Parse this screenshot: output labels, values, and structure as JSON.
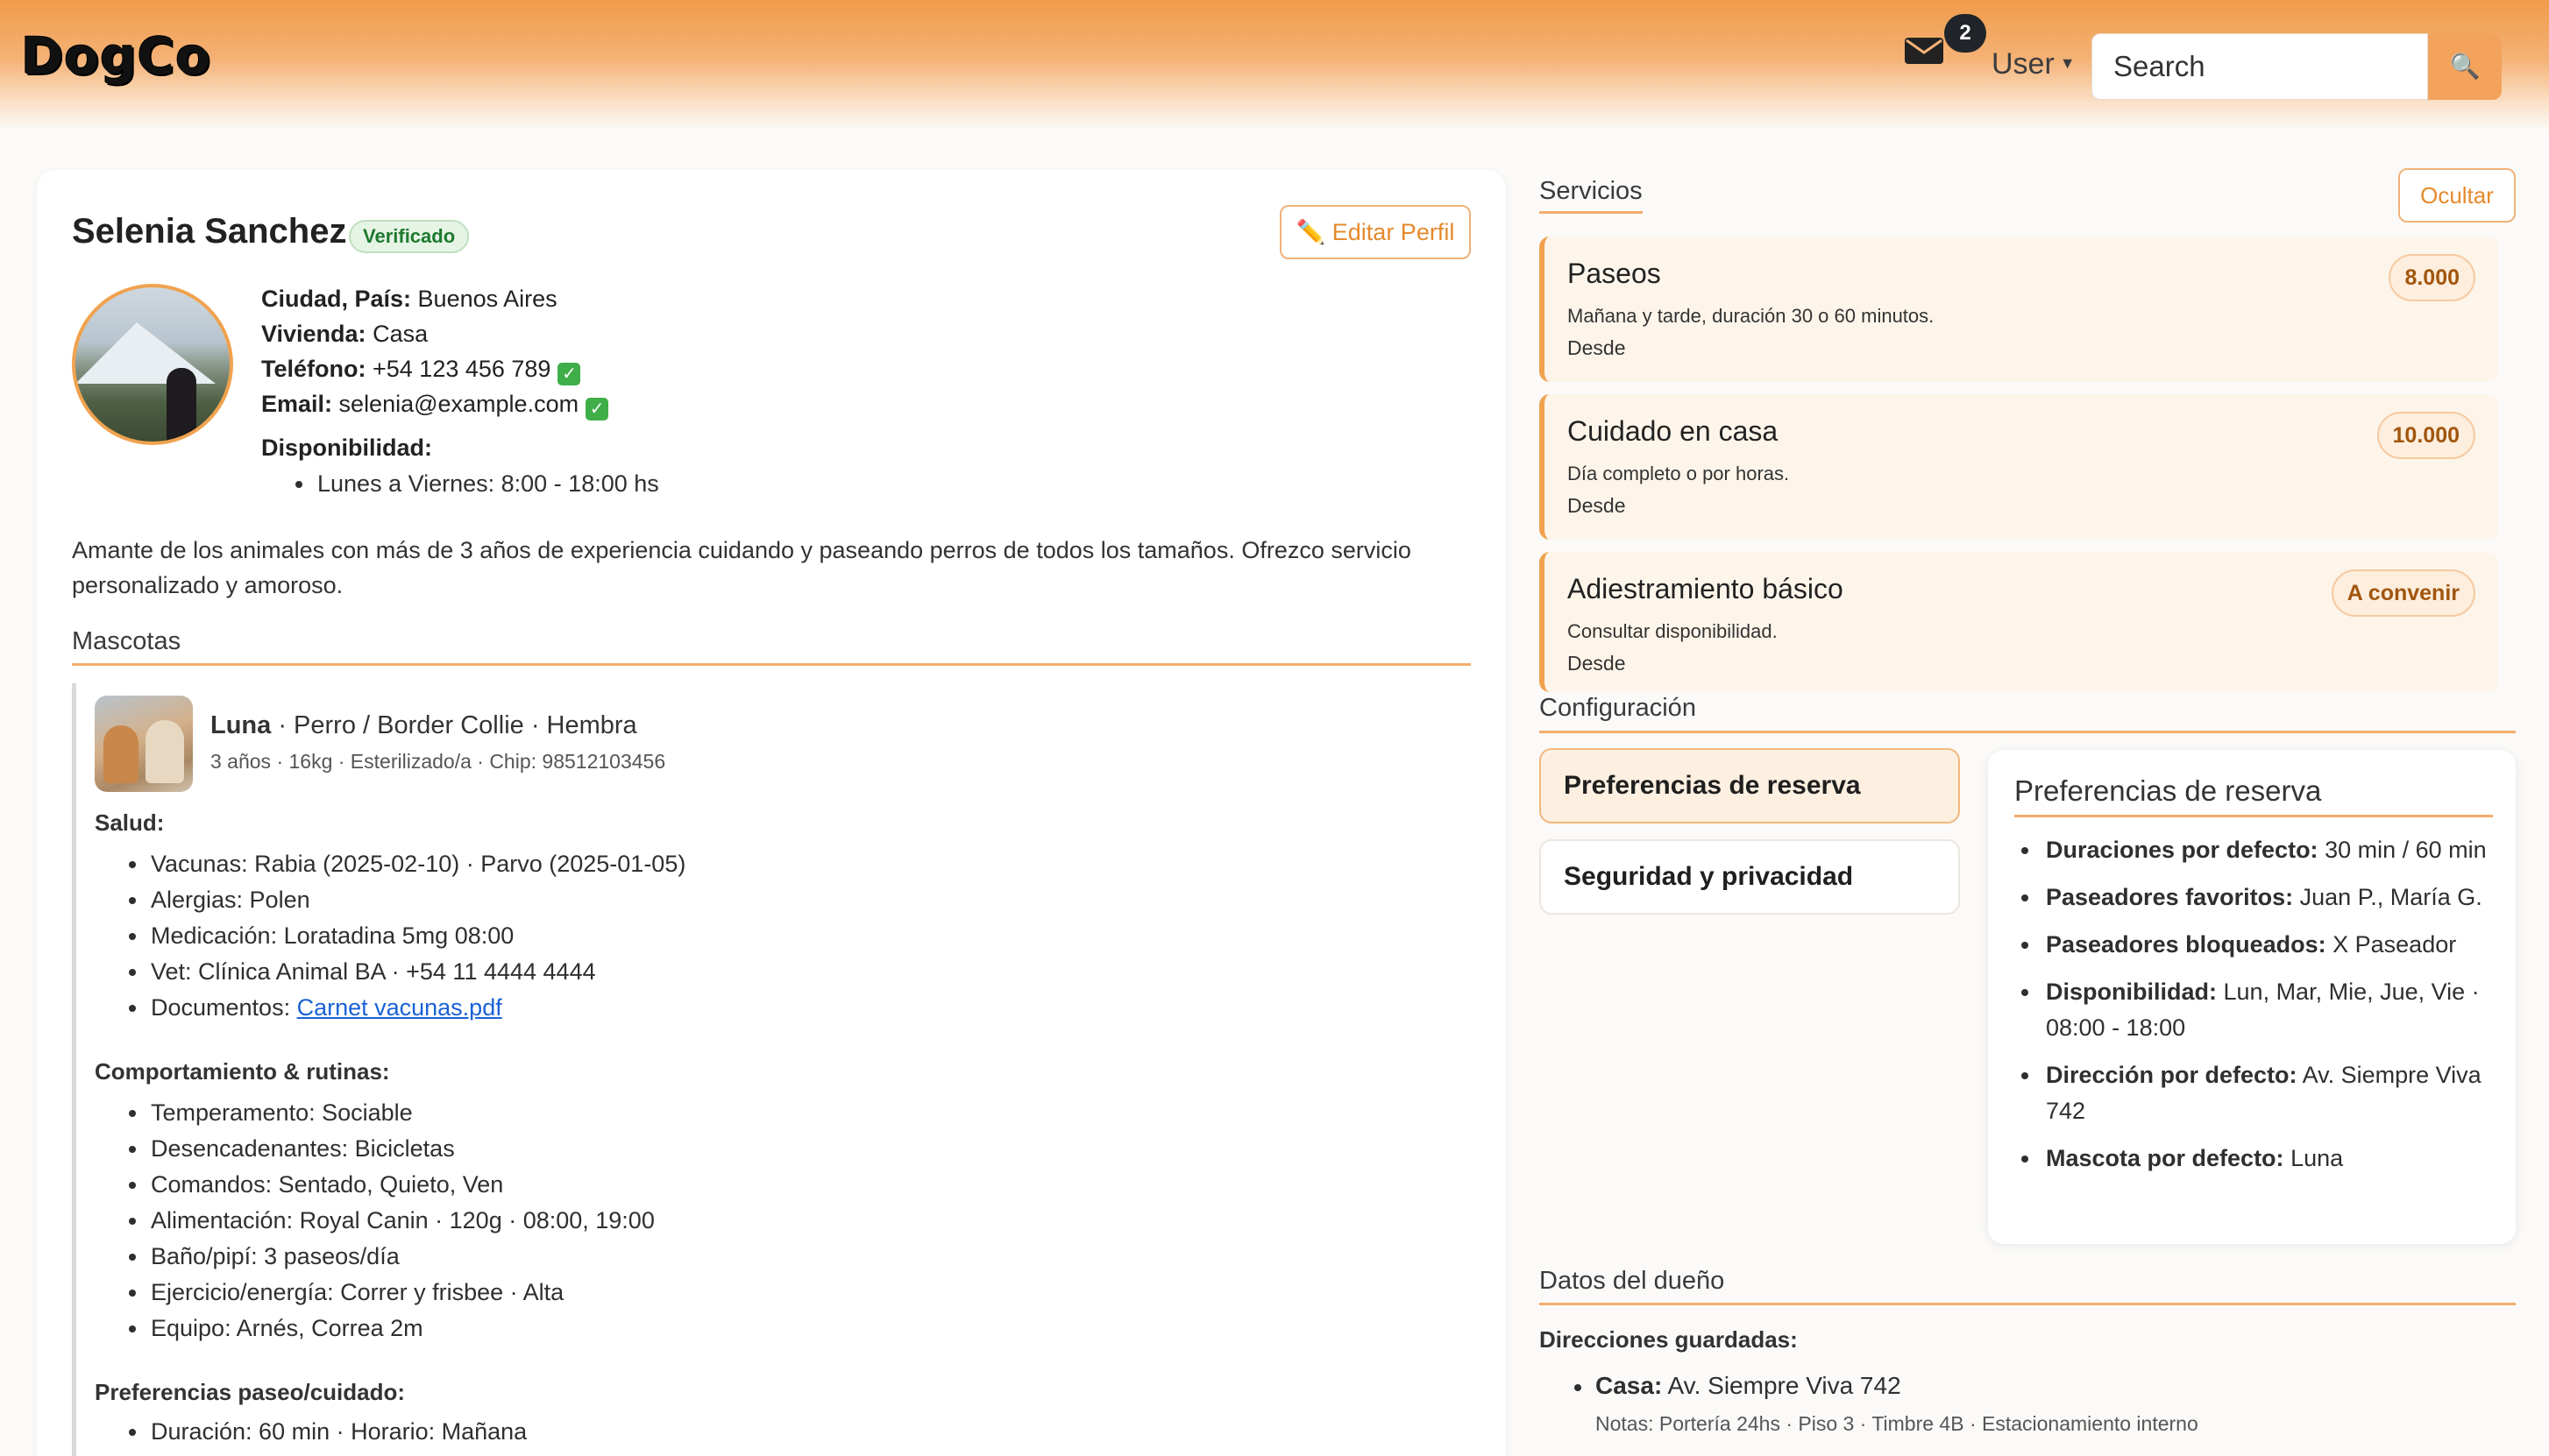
{
  "nav": {
    "brand": "DogCo",
    "unread_count": "2",
    "user_label": "User",
    "search_placeholder": "Search",
    "search_icon": "magnifier-icon"
  },
  "profile": {
    "name": "Selenia Sanchez",
    "verified_label": "Verificado",
    "edit_label": "✏️ Editar Perfil",
    "city_label": "Ciudad, País:",
    "city": "Buenos Aires",
    "housing_label": "Vivienda:",
    "housing": "Casa",
    "phone_label": "Teléfono:",
    "phone": "+54 123 456 789",
    "email_label": "Email:",
    "email": "selenia@example.com",
    "availability_label": "Disponibilidad:",
    "availability": "Lunes a Viernes: 8:00 - 18:00 hs",
    "bio": "Amante de los animales con más de 3 años de experiencia cuidando y paseando perros de todos los tamaños. Ofrezco servicio personalizado y amoroso."
  },
  "pets": {
    "title": "Mascotas",
    "pet_name": "Luna",
    "pet_desc": " · Perro / Border Collie · Hembra",
    "pet_meta": "3 años · 16kg · Esterilizado/a · Chip: 98512103456",
    "health_title": "Salud:",
    "health": [
      "Vacunas: Rabia (2025-02-10) · Parvo (2025-01-05)",
      "Alergias: Polen",
      "Medicación: Loratadina 5mg 08:00",
      "Vet: Clínica Animal BA · +54 11 4444 4444"
    ],
    "documents_label": "Documentos: ",
    "document_link": "Carnet vacunas.pdf",
    "behavior_title": "Comportamiento & rutinas:",
    "behavior": [
      "Temperamento: Sociable",
      "Desencadenantes: Bicicletas",
      "Comandos: Sentado, Quieto, Ven",
      "Alimentación: Royal Canin · 120g · 08:00, 19:00",
      "Baño/pipí: 3 paseos/día",
      "Ejercicio/energía: Correr y frisbee · Alta",
      "Equipo: Arnés, Correa 2m"
    ],
    "walk_title": "Preferencias paseo/cuidado:",
    "walk": [
      "Duración: 60 min · Horario: Mañana"
    ]
  },
  "services": {
    "title": "Servicios",
    "hide_label": "Ocultar",
    "from_label": "Desde",
    "items": [
      {
        "name": "Paseos",
        "desc": "Mañana y tarde, duración 30 o 60 minutos.",
        "price": "8.000"
      },
      {
        "name": "Cuidado en casa",
        "desc": "Día completo o por horas.",
        "price": "10.000"
      },
      {
        "name": "Adiestramiento básico",
        "desc": "Consultar disponibilidad.",
        "price": "A convenir"
      }
    ]
  },
  "config": {
    "title": "Configuración",
    "tabs": [
      "Preferencias de reserva",
      "Seguridad y privacidad"
    ],
    "panel_title": "Preferencias de reserva",
    "prefs": [
      {
        "label": "Duraciones por defecto:",
        "value": "30 min / 60 min"
      },
      {
        "label": "Paseadores favoritos:",
        "value": "Juan P., María G."
      },
      {
        "label": "Paseadores bloqueados:",
        "value": "X Paseador"
      },
      {
        "label": "Disponibilidad:",
        "value": "Lun, Mar, Mie, Jue, Vie · 08:00 - 18:00"
      },
      {
        "label": "Dirección por defecto:",
        "value": "Av. Siempre Viva 742"
      },
      {
        "label": "Mascota por defecto:",
        "value": "Luna"
      }
    ]
  },
  "owner": {
    "title": "Datos del dueño",
    "addresses_title": "Direcciones guardadas:",
    "address_label": "Casa:",
    "address": "Av. Siempre Viva 742",
    "address_notes": "Notas: Portería 24hs · Piso 3 · Timbre 4B · Estacionamiento interno"
  },
  "colors": {
    "accent": "#f0a24e",
    "accent_text": "#e58a2c",
    "verified": "#1d7a2f",
    "link": "#1a62d6"
  }
}
